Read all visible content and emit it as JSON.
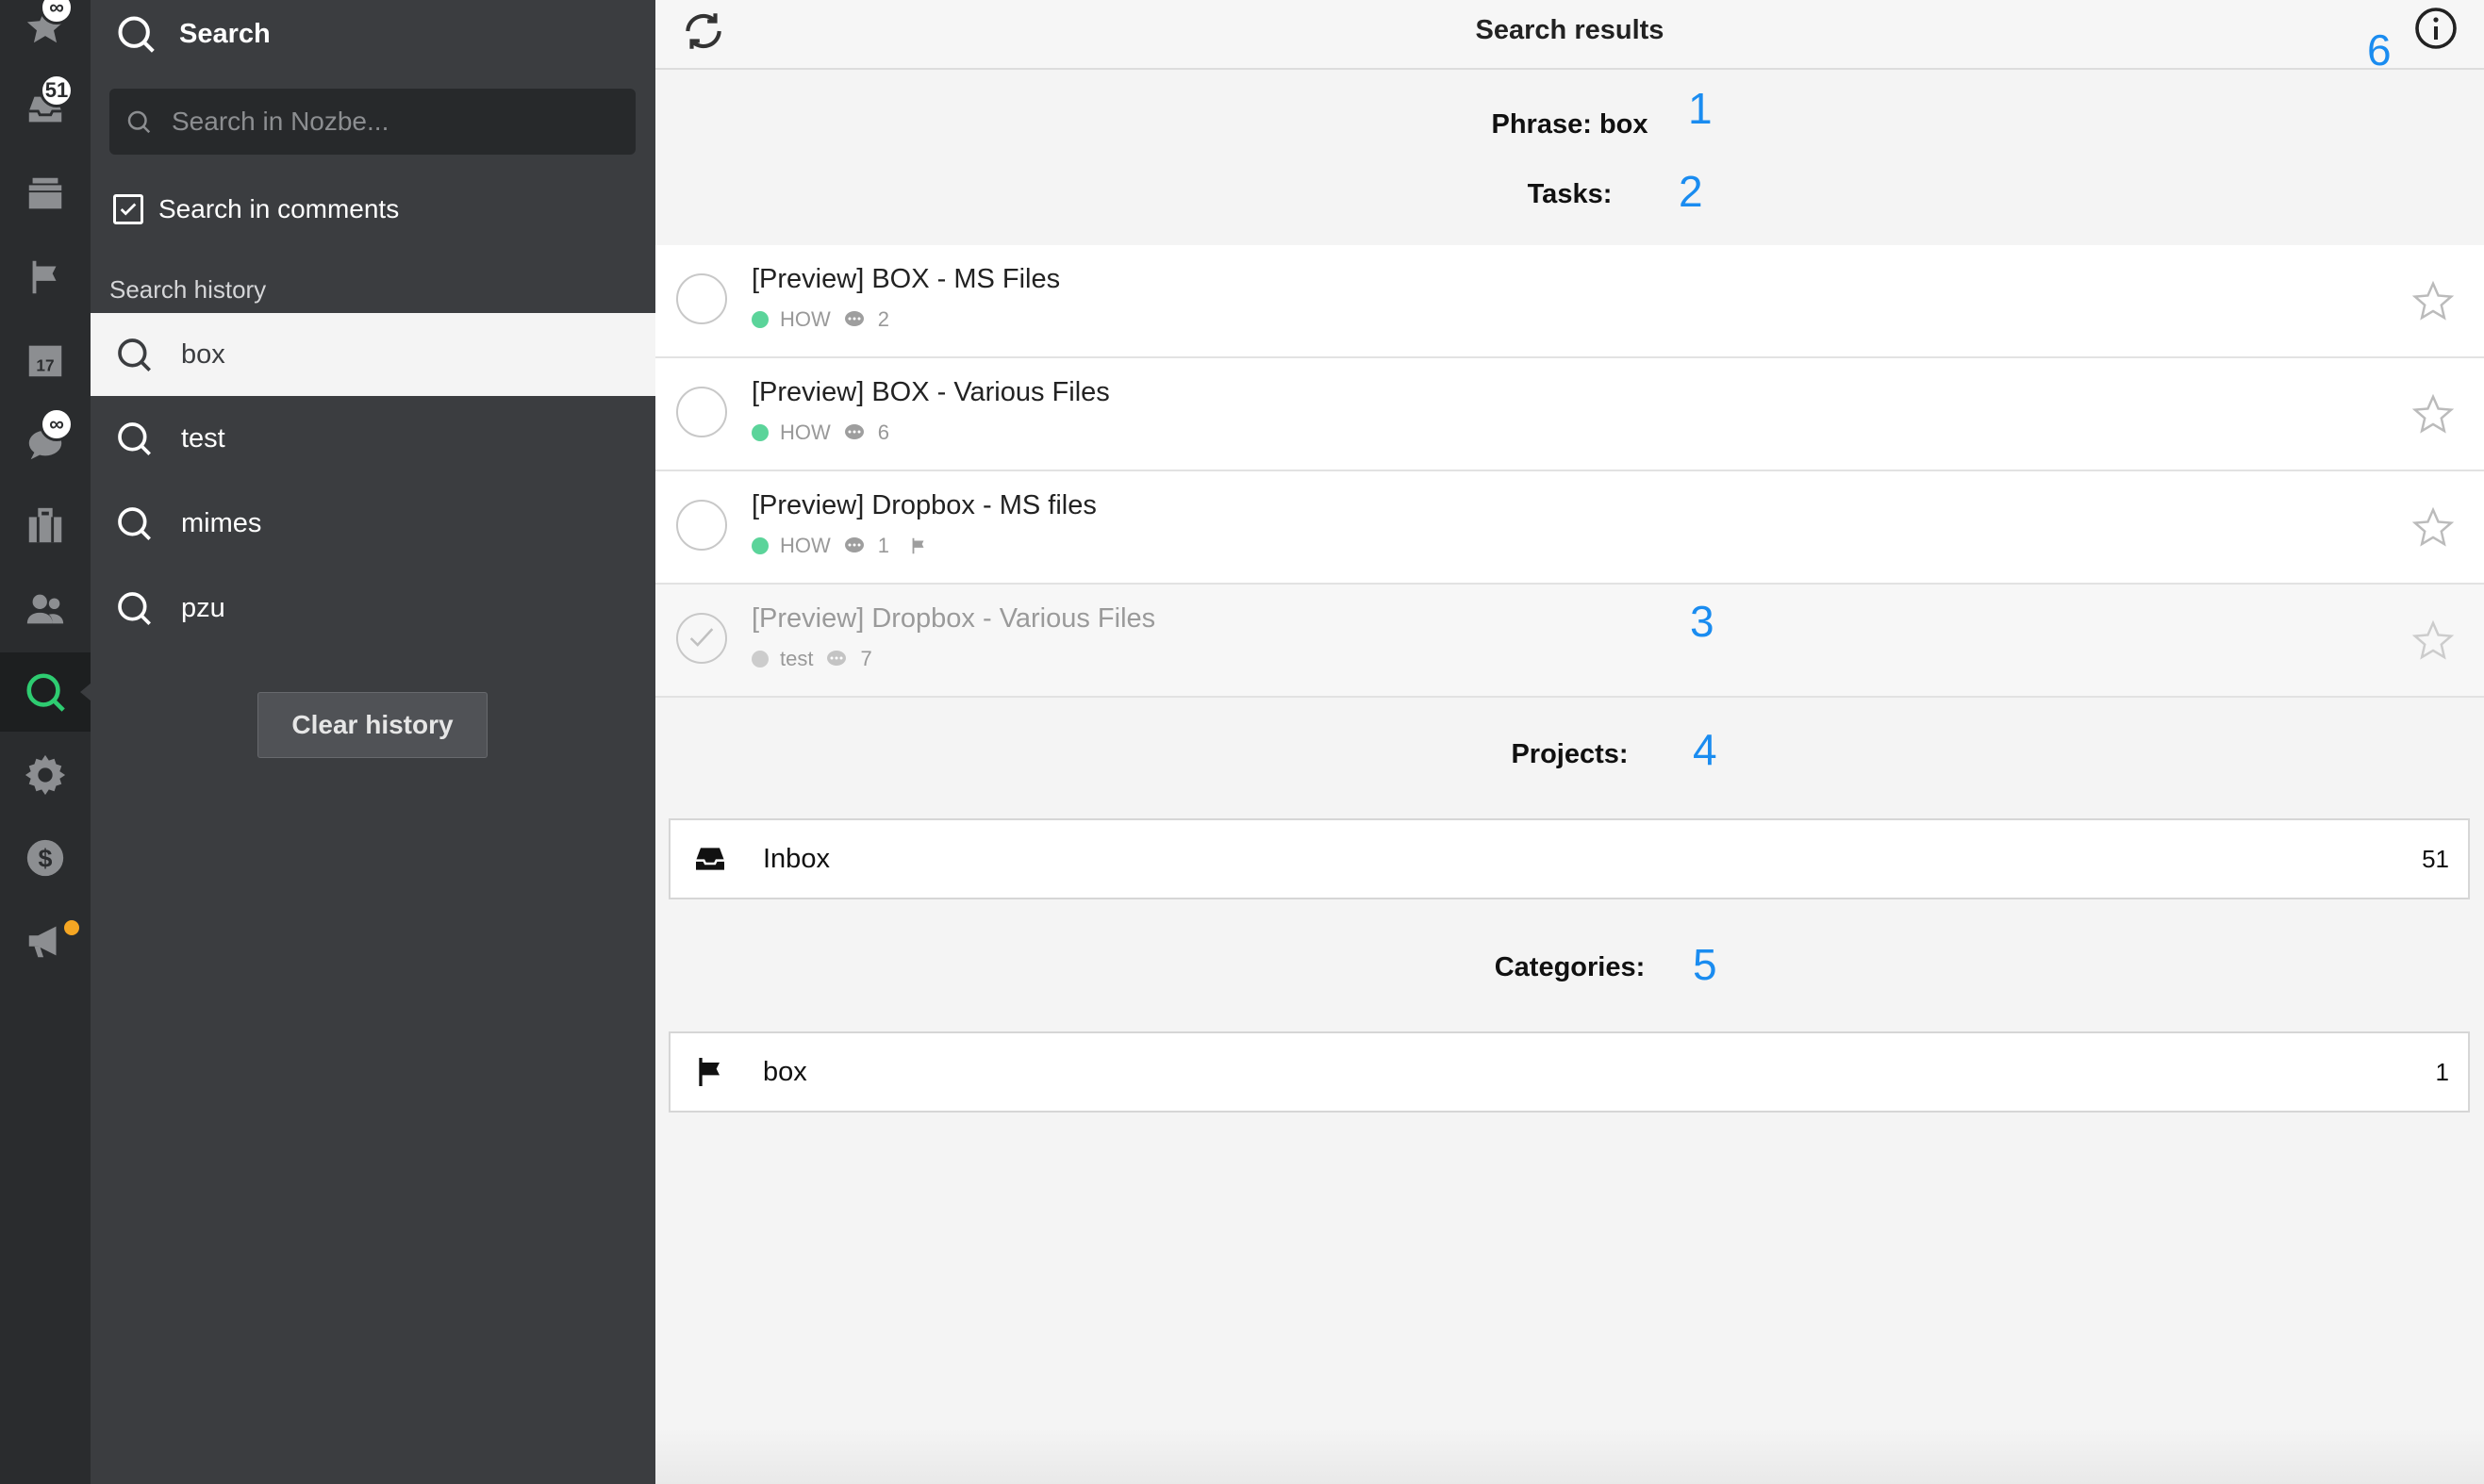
{
  "sidebar": {
    "badges": {
      "starred": "∞",
      "inbox": "51",
      "comments": "∞"
    }
  },
  "panel": {
    "title": "Search",
    "search_placeholder": "Search in Nozbe...",
    "search_in_comments_label": "Search in comments",
    "search_in_comments_checked": true,
    "history_label": "Search history",
    "history": [
      "box",
      "test",
      "mimes",
      "pzu"
    ],
    "active_history": "box",
    "clear_button": "Clear history"
  },
  "main": {
    "title": "Search results",
    "phrase": "Phrase: box",
    "tasks_label": "Tasks:",
    "tasks": [
      {
        "title": "[Preview] BOX - MS Files",
        "project": "HOW",
        "comments": "2",
        "flag": false,
        "done": false
      },
      {
        "title": "[Preview] BOX - Various Files",
        "project": "HOW",
        "comments": "6",
        "flag": false,
        "done": false
      },
      {
        "title": "[Preview] Dropbox - MS files",
        "project": "HOW",
        "comments": "1",
        "flag": true,
        "done": false
      },
      {
        "title": "[Preview] Dropbox - Various Files",
        "project": "test",
        "comments": "7",
        "flag": false,
        "done": true
      }
    ],
    "projects_label": "Projects:",
    "projects": [
      {
        "name": "Inbox",
        "count": "51"
      }
    ],
    "categories_label": "Categories:",
    "categories": [
      {
        "name": "box",
        "count": "1"
      }
    ],
    "annotations": [
      "1",
      "2",
      "3",
      "4",
      "5",
      "6"
    ]
  },
  "colors": {
    "accent": "#2ecc71",
    "annotation": "#1a8cf0",
    "project_dot": "#5bd49a",
    "notification": "#f5a623"
  }
}
